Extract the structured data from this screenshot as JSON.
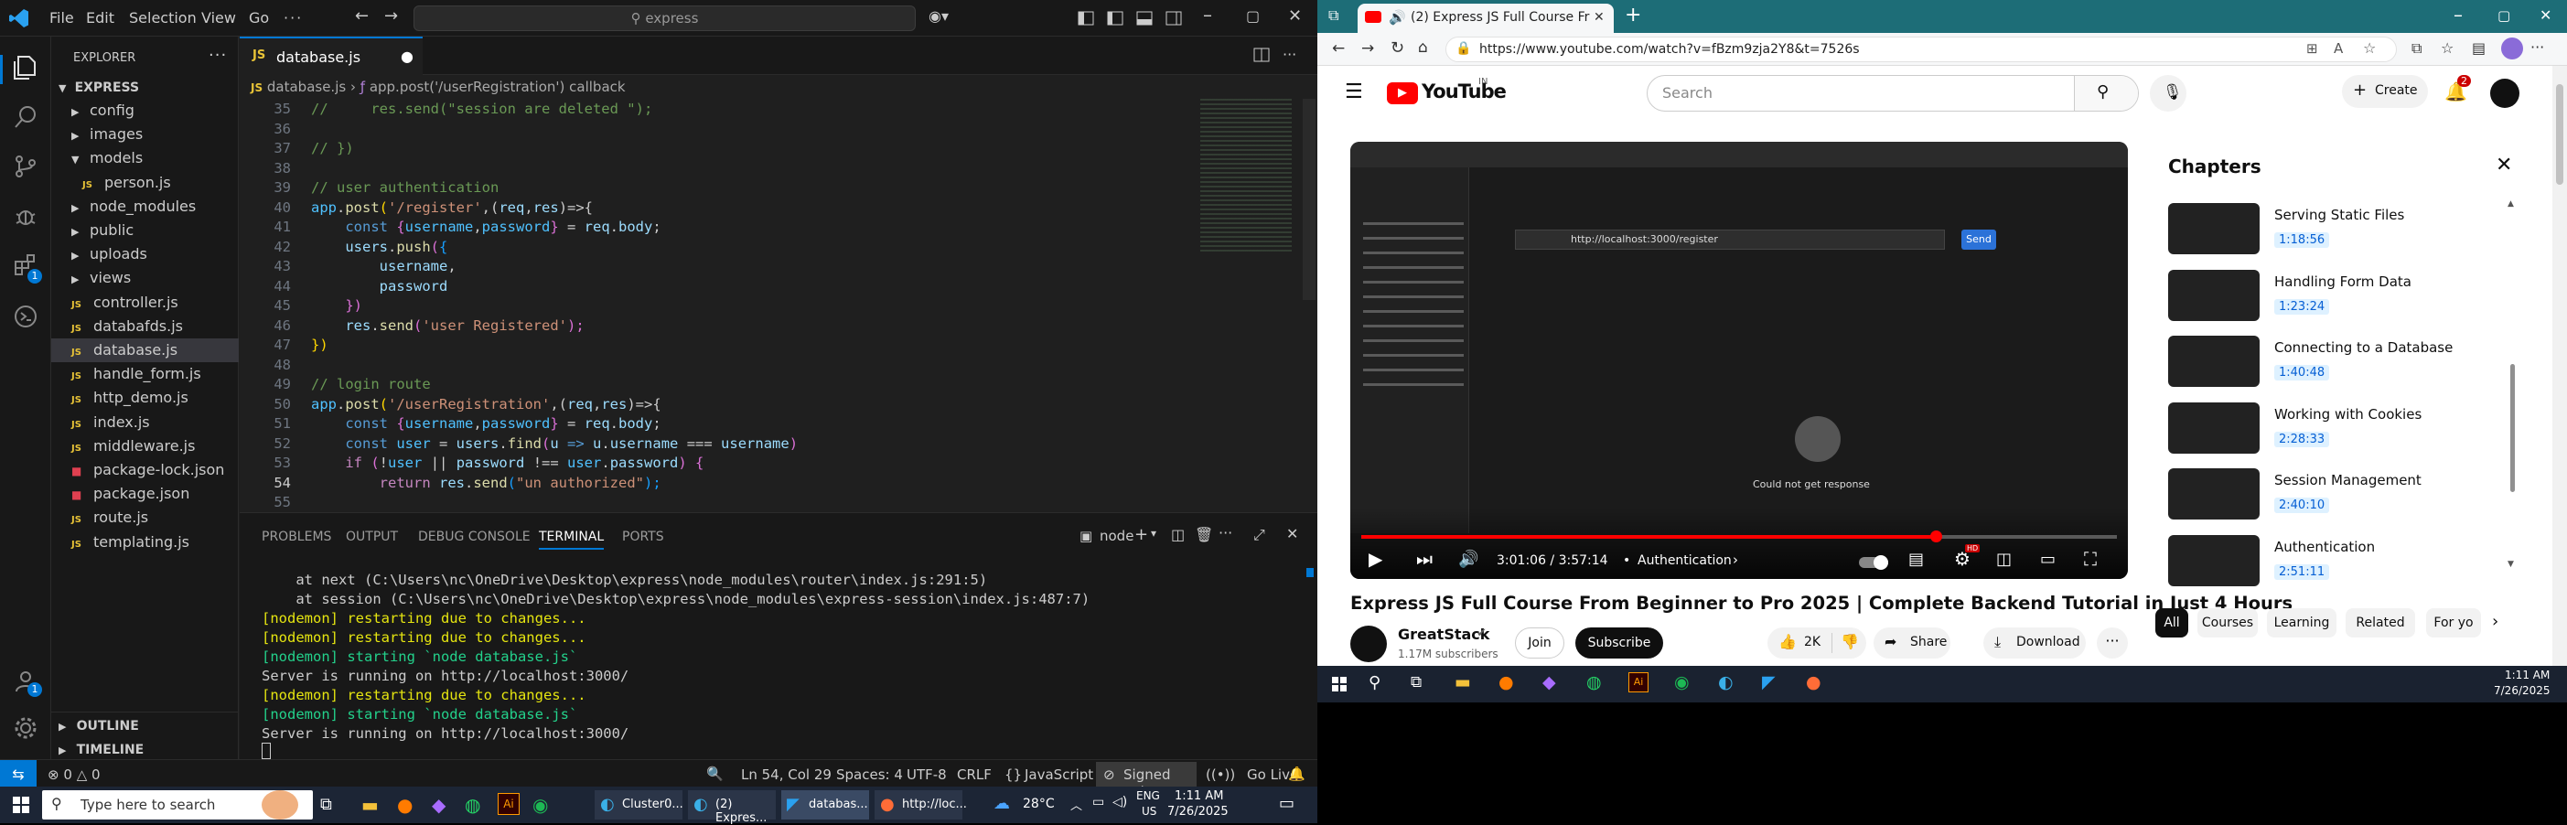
{
  "vscode": {
    "menu": [
      "File",
      "Edit",
      "Selection",
      "View",
      "Go"
    ],
    "search_text": "express",
    "explorer_title": "EXPLORER",
    "project": "EXPRESS",
    "tree": [
      {
        "label": "config",
        "kind": "folder",
        "indent": 1
      },
      {
        "label": "images",
        "kind": "folder",
        "indent": 1
      },
      {
        "label": "models",
        "kind": "folder-open",
        "indent": 1
      },
      {
        "label": "person.js",
        "kind": "js",
        "indent": 2
      },
      {
        "label": "node_modules",
        "kind": "folder",
        "indent": 1
      },
      {
        "label": "public",
        "kind": "folder",
        "indent": 1
      },
      {
        "label": "uploads",
        "kind": "folder",
        "indent": 1
      },
      {
        "label": "views",
        "kind": "folder",
        "indent": 1
      },
      {
        "label": "controller.js",
        "kind": "js",
        "indent": 1
      },
      {
        "label": "databafds.js",
        "kind": "js",
        "indent": 1
      },
      {
        "label": "database.js",
        "kind": "js",
        "indent": 1,
        "selected": true
      },
      {
        "label": "handle_form.js",
        "kind": "js",
        "indent": 1
      },
      {
        "label": "http_demo.js",
        "kind": "js",
        "indent": 1
      },
      {
        "label": "index.js",
        "kind": "js",
        "indent": 1
      },
      {
        "label": "middleware.js",
        "kind": "js",
        "indent": 1
      },
      {
        "label": "package-lock.json",
        "kind": "json",
        "indent": 1
      },
      {
        "label": "package.json",
        "kind": "json",
        "indent": 1
      },
      {
        "label": "route.js",
        "kind": "js",
        "indent": 1
      },
      {
        "label": "templating.js",
        "kind": "js",
        "indent": 1
      }
    ],
    "outline": "OUTLINE",
    "timeline": "TIMELINE",
    "tab_label": "database.js",
    "breadcrumb_file": "database.js",
    "breadcrumb_symbol": "app.post('/userRegistration') callback",
    "code": [
      {
        "n": "35",
        "segs": [
          [
            "//     res.send(\"session are deleted \");",
            "#6a9955"
          ]
        ]
      },
      {
        "n": "36",
        "segs": []
      },
      {
        "n": "37",
        "segs": [
          [
            "// })",
            "#6a9955"
          ]
        ]
      },
      {
        "n": "38",
        "segs": []
      },
      {
        "n": "39",
        "segs": [
          [
            "// user authentication",
            "#6a9955"
          ]
        ]
      },
      {
        "n": "40",
        "segs": [
          [
            "app",
            "#4fc1ff"
          ],
          [
            ".",
            "#ccc"
          ],
          [
            "post",
            "#dcdcaa"
          ],
          [
            "(",
            "#ffd700"
          ],
          [
            "'/register'",
            "#ce9178"
          ],
          [
            ",(",
            "#ccc"
          ],
          [
            "req",
            "#9cdcfe"
          ],
          [
            ",",
            "#ccc"
          ],
          [
            "res",
            "#9cdcfe"
          ],
          [
            ")=>{",
            "#ccc"
          ]
        ]
      },
      {
        "n": "41",
        "segs": [
          [
            "    const ",
            "#569cd6"
          ],
          [
            "{",
            "#da70d6"
          ],
          [
            "username",
            "#4fc1ff"
          ],
          [
            ",",
            "#ccc"
          ],
          [
            "password",
            "#4fc1ff"
          ],
          [
            "} ",
            "#da70d6"
          ],
          [
            "= ",
            "#ccc"
          ],
          [
            "req",
            "#9cdcfe"
          ],
          [
            ".",
            "#ccc"
          ],
          [
            "body",
            "#9cdcfe"
          ],
          [
            ";",
            "#ccc"
          ]
        ]
      },
      {
        "n": "42",
        "segs": [
          [
            "    users",
            "#9cdcfe"
          ],
          [
            ".",
            "#ccc"
          ],
          [
            "push",
            "#dcdcaa"
          ],
          [
            "(",
            "#da70d6"
          ],
          [
            "{",
            "#179fff"
          ]
        ]
      },
      {
        "n": "43",
        "segs": [
          [
            "        username",
            "#9cdcfe"
          ],
          [
            ",",
            "#ccc"
          ]
        ]
      },
      {
        "n": "44",
        "segs": [
          [
            "        password",
            "#9cdcfe"
          ]
        ]
      },
      {
        "n": "45",
        "segs": [
          [
            "    })",
            "#da70d6"
          ]
        ]
      },
      {
        "n": "46",
        "segs": [
          [
            "    res",
            "#9cdcfe"
          ],
          [
            ".",
            "#ccc"
          ],
          [
            "send",
            "#dcdcaa"
          ],
          [
            "(",
            "#da70d6"
          ],
          [
            "'user Registered'",
            "#ce9178"
          ],
          [
            ");",
            "#da70d6"
          ]
        ]
      },
      {
        "n": "47",
        "segs": [
          [
            "})",
            "#ffd700"
          ]
        ]
      },
      {
        "n": "48",
        "segs": []
      },
      {
        "n": "49",
        "segs": [
          [
            "// login route",
            "#6a9955"
          ]
        ]
      },
      {
        "n": "50",
        "segs": [
          [
            "app",
            "#4fc1ff"
          ],
          [
            ".",
            "#ccc"
          ],
          [
            "post",
            "#dcdcaa"
          ],
          [
            "(",
            "#ffd700"
          ],
          [
            "'/userRegistration'",
            "#ce9178"
          ],
          [
            ",(",
            "#ccc"
          ],
          [
            "req",
            "#9cdcfe"
          ],
          [
            ",",
            "#ccc"
          ],
          [
            "res",
            "#9cdcfe"
          ],
          [
            ")=>{",
            "#ccc"
          ]
        ]
      },
      {
        "n": "51",
        "segs": [
          [
            "    const ",
            "#569cd6"
          ],
          [
            "{",
            "#da70d6"
          ],
          [
            "username",
            "#4fc1ff"
          ],
          [
            ",",
            "#ccc"
          ],
          [
            "password",
            "#4fc1ff"
          ],
          [
            "} ",
            "#da70d6"
          ],
          [
            "= ",
            "#ccc"
          ],
          [
            "req",
            "#9cdcfe"
          ],
          [
            ".",
            "#ccc"
          ],
          [
            "body",
            "#9cdcfe"
          ],
          [
            ";",
            "#ccc"
          ]
        ]
      },
      {
        "n": "52",
        "segs": [
          [
            "    const ",
            "#569cd6"
          ],
          [
            "user ",
            "#4fc1ff"
          ],
          [
            "= ",
            "#ccc"
          ],
          [
            "users",
            "#9cdcfe"
          ],
          [
            ".",
            "#ccc"
          ],
          [
            "find",
            "#dcdcaa"
          ],
          [
            "(",
            "#da70d6"
          ],
          [
            "u ",
            "#9cdcfe"
          ],
          [
            "=> ",
            "#569cd6"
          ],
          [
            "u",
            "#9cdcfe"
          ],
          [
            ".",
            "#ccc"
          ],
          [
            "username ",
            "#9cdcfe"
          ],
          [
            "=== ",
            "#ccc"
          ],
          [
            "username",
            "#9cdcfe"
          ],
          [
            ")",
            "#da70d6"
          ]
        ]
      },
      {
        "n": "53",
        "segs": [
          [
            "    if ",
            "#c586c0"
          ],
          [
            "(",
            "#da70d6"
          ],
          [
            "!",
            "#ccc"
          ],
          [
            "user ",
            "#4fc1ff"
          ],
          [
            "|| ",
            "#ccc"
          ],
          [
            "password ",
            "#9cdcfe"
          ],
          [
            "!== ",
            "#ccc"
          ],
          [
            "user",
            "#4fc1ff"
          ],
          [
            ".",
            "#ccc"
          ],
          [
            "password",
            "#9cdcfe"
          ],
          [
            ") {",
            "#da70d6"
          ]
        ]
      },
      {
        "n": "54",
        "segs": [
          [
            "        return ",
            "#c586c0"
          ],
          [
            "res",
            "#9cdcfe"
          ],
          [
            ".",
            "#ccc"
          ],
          [
            "send",
            "#dcdcaa"
          ],
          [
            "(",
            "#179fff"
          ],
          [
            "\"un authorized\"",
            "#ce9178"
          ],
          [
            ");",
            "#179fff"
          ]
        ]
      },
      {
        "n": "55",
        "segs": []
      }
    ],
    "panel_tabs": [
      "PROBLEMS",
      "OUTPUT",
      "DEBUG CONSOLE",
      "TERMINAL",
      "PORTS"
    ],
    "terminal_shell": "node",
    "terminal": [
      {
        "text": "    at next (C:\\Users\\nc\\OneDrive\\Desktop\\express\\node_modules\\router\\index.js:291:5)",
        "color": "#cccccc"
      },
      {
        "text": "    at session (C:\\Users\\nc\\OneDrive\\Desktop\\express\\node_modules\\express-session\\index.js:487:7)",
        "color": "#cccccc"
      },
      {
        "text": "[nodemon] restarting due to changes...",
        "color": "#e5e510"
      },
      {
        "text": "[nodemon] restarting due to changes...",
        "color": "#e5e510"
      },
      {
        "text": "[nodemon] starting `node database.js`",
        "color": "#23d18b"
      },
      {
        "text": "Server is running on http://localhost:3000/",
        "color": "#cccccc"
      },
      {
        "text": "[nodemon] restarting due to changes...",
        "color": "#e5e510"
      },
      {
        "text": "[nodemon] starting `node database.js`",
        "color": "#23d18b"
      },
      {
        "text": "Server is running on http://localhost:3000/",
        "color": "#cccccc"
      }
    ],
    "status": {
      "errors": "0",
      "warnings": "0",
      "position": "Ln 54, Col 29",
      "spaces": "Spaces: 4",
      "encoding": "UTF-8",
      "eol": "CRLF",
      "language": "JavaScript",
      "signed": "Signed out",
      "golive": "Go Live"
    },
    "taskbar": {
      "search_placeholder": "Type here to search",
      "apps": [
        "Cluster0...",
        "(2) Expres...",
        "databas...",
        "http://loc..."
      ],
      "temp": "28°C",
      "lang1": "ENG",
      "lang2": "US",
      "time": "1:11 AM",
      "date": "7/26/2025"
    }
  },
  "edge": {
    "tab_title": "(2) Express JS Full Course Fr",
    "url": "https://www.youtube.com/watch?v=fBzm9zja2Y8&t=7526s",
    "yt_country": "IN",
    "yt_logo": "YouTube",
    "search_placeholder": "Search",
    "create": "Create",
    "notif_count": "2",
    "video_time": "3:01:06 / 3:57:14",
    "chapter_now": "Authentication",
    "video_title": "Express JS Full Course From Beginner to Pro 2025 | Complete Backend Tutorial in Just 4 Hours",
    "channel": "GreatStack",
    "subs": "1.17M subscribers",
    "join": "Join",
    "subscribe": "Subscribe",
    "likes": "2K",
    "share": "Share",
    "download": "Download",
    "chapters_title": "Chapters",
    "chapters": [
      {
        "title": "Serving Static Files",
        "ts": "1:18:56"
      },
      {
        "title": "Handling Form Data",
        "ts": "1:23:24"
      },
      {
        "title": "Connecting to a Database",
        "ts": "1:40:48"
      },
      {
        "title": "Working with Cookies",
        "ts": "2:28:33"
      },
      {
        "title": "Session Management",
        "ts": "2:40:10"
      },
      {
        "title": "Authentication",
        "ts": "2:51:11"
      }
    ],
    "pills": [
      "All",
      "Courses",
      "Learning",
      "Related",
      "For yo"
    ],
    "progress": 0.7598,
    "postman_url": "http://localhost:3000/register",
    "postman_send": "Send",
    "postman_msg": "Could not get response",
    "taskbar_time": "1:11 AM",
    "taskbar_date": "7/26/2025"
  },
  "colors": {
    "accent": "#0078d4",
    "yt_red": "#ff0000",
    "vscode_bg": "#1f1f1f"
  }
}
